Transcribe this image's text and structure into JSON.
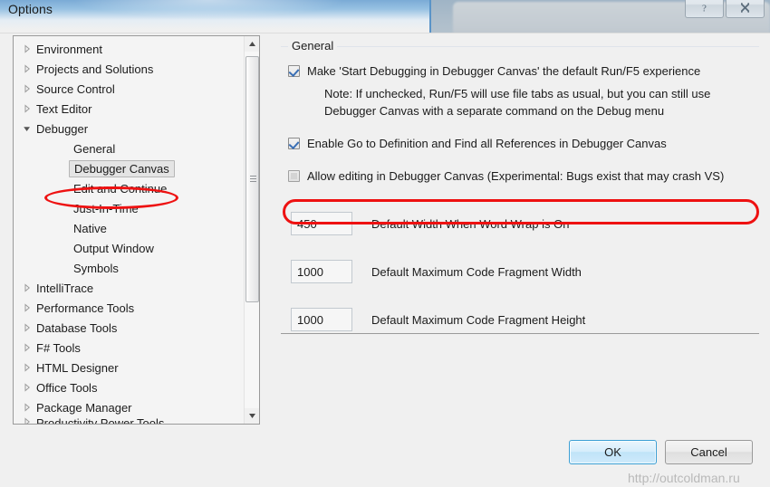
{
  "window": {
    "title": "Options",
    "help_button": "?",
    "close_button": "×"
  },
  "tree": {
    "items": [
      {
        "label": "Environment",
        "level": 0,
        "state": "collapsed",
        "selected": false
      },
      {
        "label": "Projects and Solutions",
        "level": 0,
        "state": "collapsed",
        "selected": false
      },
      {
        "label": "Source Control",
        "level": 0,
        "state": "collapsed",
        "selected": false
      },
      {
        "label": "Text Editor",
        "level": 0,
        "state": "collapsed",
        "selected": false
      },
      {
        "label": "Debugger",
        "level": 0,
        "state": "expanded",
        "selected": false
      },
      {
        "label": "General",
        "level": 1,
        "state": "leaf",
        "selected": false
      },
      {
        "label": "Debugger Canvas",
        "level": 1,
        "state": "leaf",
        "selected": true
      },
      {
        "label": "Edit and Continue",
        "level": 1,
        "state": "leaf",
        "selected": false
      },
      {
        "label": "Just-In-Time",
        "level": 1,
        "state": "leaf",
        "selected": false
      },
      {
        "label": "Native",
        "level": 1,
        "state": "leaf",
        "selected": false
      },
      {
        "label": "Output Window",
        "level": 1,
        "state": "leaf",
        "selected": false
      },
      {
        "label": "Symbols",
        "level": 1,
        "state": "leaf",
        "selected": false
      },
      {
        "label": "IntelliTrace",
        "level": 0,
        "state": "collapsed",
        "selected": false
      },
      {
        "label": "Performance Tools",
        "level": 0,
        "state": "collapsed",
        "selected": false
      },
      {
        "label": "Database Tools",
        "level": 0,
        "state": "collapsed",
        "selected": false
      },
      {
        "label": "F# Tools",
        "level": 0,
        "state": "collapsed",
        "selected": false
      },
      {
        "label": "HTML Designer",
        "level": 0,
        "state": "collapsed",
        "selected": false
      },
      {
        "label": "Office Tools",
        "level": 0,
        "state": "collapsed",
        "selected": false
      },
      {
        "label": "Package Manager",
        "level": 0,
        "state": "collapsed",
        "selected": false
      },
      {
        "label": "Productivity Power Tools",
        "level": 0,
        "state": "collapsed",
        "selected": false,
        "clipped": true
      }
    ],
    "scrollbar": {
      "up_arrow": "▲",
      "down_arrow": "▼"
    }
  },
  "general": {
    "group_title": "General",
    "checkbox_default_f5": {
      "label": "Make 'Start Debugging in Debugger Canvas' the default Run/F5 experience",
      "checked": true
    },
    "note_line1": "Note: If unchecked, Run/F5 will use file tabs as usual, but you can still use",
    "note_line2": "Debugger Canvas with a separate command on the Debug menu",
    "checkbox_goto_definition": {
      "label": "Enable Go to Definition and Find all References in Debugger Canvas",
      "checked": true
    },
    "checkbox_allow_editing": {
      "label": "Allow editing in Debugger Canvas (Experimental: Bugs exist that may crash VS)",
      "checked": false
    },
    "fields": [
      {
        "value": "450",
        "label": "Default Width When Word Wrap is On"
      },
      {
        "value": "1000",
        "label": "Default Maximum Code Fragment Width"
      },
      {
        "value": "1000",
        "label": "Default Maximum Code Fragment Height"
      }
    ]
  },
  "footer": {
    "ok_label": "OK",
    "cancel_label": "Cancel"
  },
  "watermark": "http://outcoldman.ru",
  "colors": {
    "annotation_red": "#ee1111",
    "accent_blue": "#3c9fd4",
    "dialog_bg": "#f0f0f0"
  }
}
